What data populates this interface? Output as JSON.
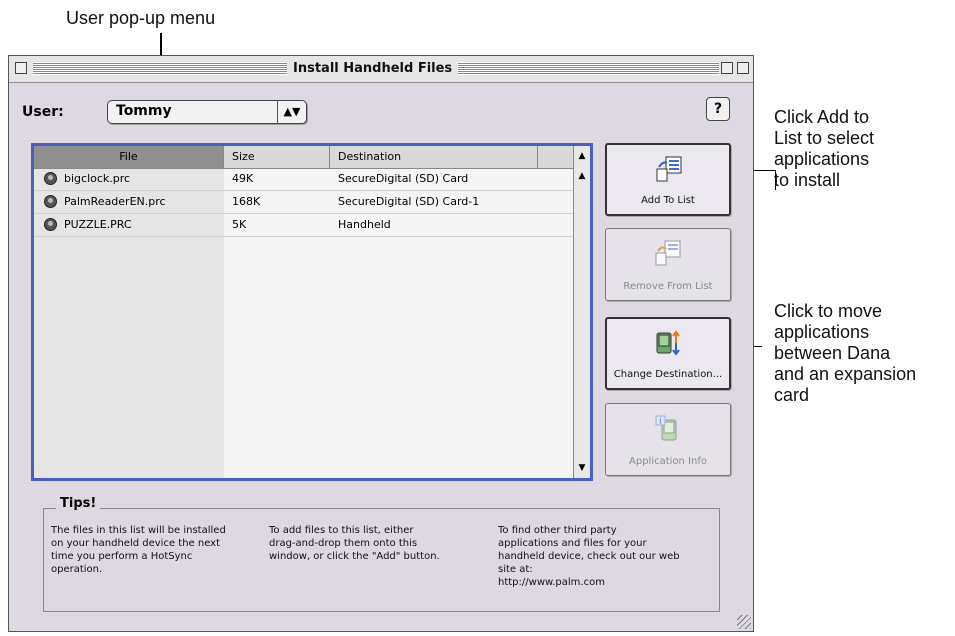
{
  "callouts": {
    "user_popup": "User pop-up menu",
    "add_to_list": "Click Add to\nList to select\napplications\nto install",
    "change_destination": "Click to move\napplications\nbetween Dana\nand an expansion\ncard"
  },
  "window": {
    "title": "Install Handheld Files"
  },
  "user": {
    "label": "User:",
    "value": "Tommy"
  },
  "help_icon": "?",
  "table": {
    "columns": [
      "File",
      "Size",
      "Destination"
    ],
    "rows": [
      {
        "file": "bigclock.prc",
        "size": "49K",
        "destination": "SecureDigital (SD) Card"
      },
      {
        "file": "PalmReaderEN.prc",
        "size": "168K",
        "destination": "SecureDigital (SD) Card-1"
      },
      {
        "file": "PUZZLE.PRC",
        "size": "5K",
        "destination": "Handheld"
      }
    ]
  },
  "buttons": {
    "add": "Add To List",
    "remove": "Remove From List",
    "change": "Change Destination...",
    "info": "Application Info"
  },
  "tips": {
    "title": "Tips!",
    "col1": "The files in this list will be installed\non your handheld device the next\ntime you perform a HotSync\noperation.",
    "col2": "To add files to this list, either\ndrag-and-drop them onto this\nwindow, or click the \"Add\" button.",
    "col3": "To find other third party\napplications and files for your\nhandheld device, check out our web\nsite at:\nhttp://www.palm.com"
  },
  "colors": {
    "accent": "#4a5fc4",
    "window_bg": "#ddd8e2"
  }
}
